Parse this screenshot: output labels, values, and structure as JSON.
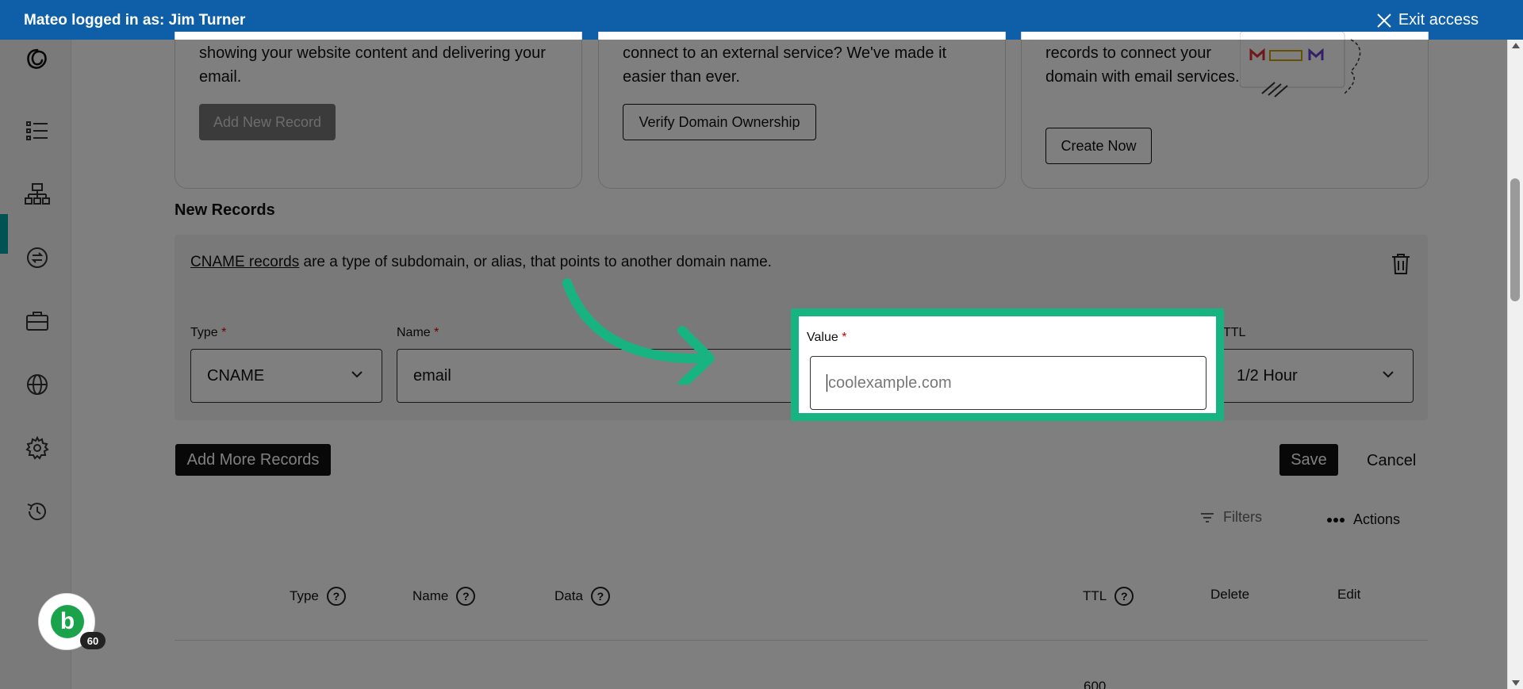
{
  "banner": {
    "logged_in_text": "Mateo logged in as: Jim Turner",
    "exit_label": "Exit access"
  },
  "cards": [
    {
      "text": "showing your website content and delivering your email.",
      "button": "Add New Record"
    },
    {
      "text": "connect to an external service? We've made it easier than ever.",
      "button": "Verify Domain Ownership"
    },
    {
      "text": "records to connect your domain with email services.",
      "button": "Create Now"
    }
  ],
  "new_records": {
    "title": "New Records",
    "desc_link": "CNAME records",
    "desc_rest": " are a type of subdomain, or alias, that points to another domain name.",
    "type_label": "Type",
    "type_value": "CNAME",
    "name_label": "Name",
    "name_value": "email",
    "value_label": "Value",
    "value_placeholder": "coolexample.com",
    "ttl_label": "TTL",
    "ttl_value": "1/2 Hour",
    "required_mark": "*"
  },
  "actions": {
    "add_more": "Add More Records",
    "save": "Save",
    "cancel": "Cancel",
    "filters": "Filters",
    "actions": "Actions"
  },
  "table": {
    "columns": [
      "Type",
      "Name",
      "Data",
      "TTL",
      "Delete",
      "Edit"
    ],
    "first_row_ttl": "600"
  },
  "avatar": {
    "letter": "b",
    "badge": "60"
  },
  "colors": {
    "banner": "#0f5fa8",
    "highlight": "#17b482",
    "accent": "#00a4a6"
  }
}
